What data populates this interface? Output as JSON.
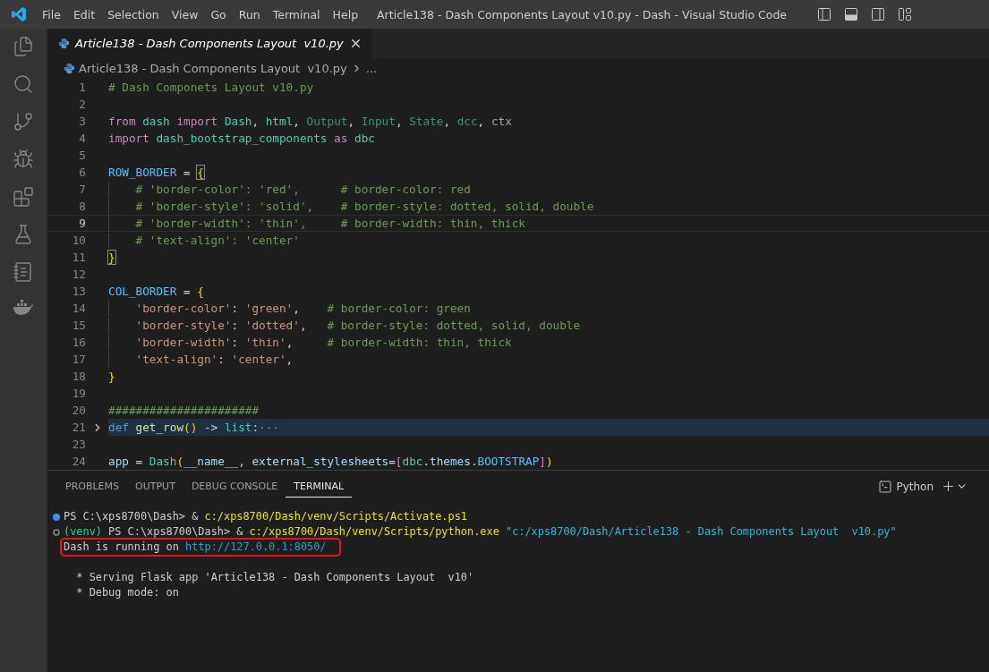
{
  "window": {
    "title": "Article138 - Dash Components Layout v10.py - Dash - Visual Studio Code",
    "menu": [
      "File",
      "Edit",
      "Selection",
      "View",
      "Go",
      "Run",
      "Terminal",
      "Help"
    ]
  },
  "tabs": [
    {
      "label": "Article138 - Dash Components Layout  v10.py",
      "selected": true,
      "italic": true
    }
  ],
  "breadcrumb": {
    "file": "Article138 - Dash Components Layout  v10.py",
    "more": "..."
  },
  "editor": {
    "lines": [
      {
        "number": "1",
        "current": false,
        "selected": false,
        "folded": false,
        "tokens": [
          {
            "kind": "comment",
            "text": "# Dash Componets Layout v10.py"
          }
        ]
      },
      {
        "number": "2",
        "current": false,
        "selected": false,
        "folded": false
      },
      {
        "number": "3",
        "current": false,
        "selected": false,
        "folded": false,
        "tokens": [
          {
            "kind": "control",
            "text": "from "
          },
          {
            "kind": "type",
            "text": "dash "
          },
          {
            "kind": "control",
            "text": "import "
          },
          {
            "kind": "type",
            "text": "Dash"
          },
          {
            "kind": "plain",
            "text": ", "
          },
          {
            "kind": "type",
            "text": "html"
          },
          {
            "kind": "plain",
            "text": ", "
          },
          {
            "kind": "faded",
            "text": "Output"
          },
          {
            "kind": "plain",
            "text": ", "
          },
          {
            "kind": "faded",
            "text": "Input"
          },
          {
            "kind": "plain",
            "text": ", "
          },
          {
            "kind": "faded",
            "text": "State"
          },
          {
            "kind": "plain",
            "text": ", "
          },
          {
            "kind": "faded",
            "text": "dcc"
          },
          {
            "kind": "plain",
            "text": ", "
          },
          {
            "kind": "dim",
            "text": "ctx"
          }
        ]
      },
      {
        "number": "4",
        "current": false,
        "selected": false,
        "folded": false,
        "tokens": [
          {
            "kind": "control",
            "text": "import "
          },
          {
            "kind": "type",
            "text": "dash_bootstrap_components "
          },
          {
            "kind": "control",
            "text": "as "
          },
          {
            "kind": "type",
            "text": "dbc"
          }
        ]
      },
      {
        "number": "5",
        "current": false,
        "selected": false,
        "folded": false
      },
      {
        "number": "6",
        "current": false,
        "selected": false,
        "folded": false,
        "tokens": [
          {
            "kind": "constant",
            "text": "ROW_BORDER"
          },
          {
            "kind": "plain",
            "text": " = "
          },
          {
            "kind": "bracket-match",
            "text": "{"
          }
        ]
      },
      {
        "number": "7",
        "current": false,
        "selected": false,
        "folded": false,
        "tokens": [
          {
            "kind": "comment",
            "text": "    # 'border-color': 'red',      # border-color: red"
          }
        ]
      },
      {
        "number": "8",
        "current": false,
        "selected": false,
        "folded": false,
        "tokens": [
          {
            "kind": "comment",
            "text": "    # 'border-style': 'solid',    # border-style: dotted, solid, double"
          }
        ]
      },
      {
        "number": "9",
        "current": true,
        "selected": false,
        "folded": false,
        "tokens": [
          {
            "kind": "comment",
            "text": "    # 'border-width': 'thin',     # border-width: thin, thick"
          }
        ]
      },
      {
        "number": "10",
        "current": false,
        "selected": false,
        "folded": false,
        "tokens": [
          {
            "kind": "comment",
            "text": "    # 'text-align': 'center'"
          }
        ]
      },
      {
        "number": "11",
        "current": false,
        "selected": false,
        "folded": false,
        "tokens": [
          {
            "kind": "bracket-match",
            "text": "}"
          }
        ]
      },
      {
        "number": "12",
        "current": false,
        "selected": false,
        "folded": false
      },
      {
        "number": "13",
        "current": false,
        "selected": false,
        "folded": false,
        "tokens": [
          {
            "kind": "constant",
            "text": "COL_BORDER"
          },
          {
            "kind": "plain",
            "text": " = "
          },
          {
            "kind": "bracket",
            "text": "{"
          }
        ]
      },
      {
        "number": "14",
        "current": false,
        "selected": false,
        "folded": false,
        "tokens": [
          {
            "kind": "string",
            "text": "    'border-color'"
          },
          {
            "kind": "plain",
            "text": ": "
          },
          {
            "kind": "string",
            "text": "'green'"
          },
          {
            "kind": "plain",
            "text": ",    "
          },
          {
            "kind": "comment",
            "text": "# border-color: green"
          }
        ]
      },
      {
        "number": "15",
        "current": false,
        "selected": false,
        "folded": false,
        "tokens": [
          {
            "kind": "string",
            "text": "    'border-style'"
          },
          {
            "kind": "plain",
            "text": ": "
          },
          {
            "kind": "string",
            "text": "'dotted'"
          },
          {
            "kind": "plain",
            "text": ",   "
          },
          {
            "kind": "comment",
            "text": "# border-style: dotted, solid, double"
          }
        ]
      },
      {
        "number": "16",
        "current": false,
        "selected": false,
        "folded": false,
        "tokens": [
          {
            "kind": "string",
            "text": "    'border-width'"
          },
          {
            "kind": "plain",
            "text": ": "
          },
          {
            "kind": "string",
            "text": "'thin'"
          },
          {
            "kind": "plain",
            "text": ",     "
          },
          {
            "kind": "comment",
            "text": "# border-width: thin, thick"
          }
        ]
      },
      {
        "number": "17",
        "current": false,
        "selected": false,
        "folded": false,
        "tokens": [
          {
            "kind": "string",
            "text": "    'text-align'"
          },
          {
            "kind": "plain",
            "text": ": "
          },
          {
            "kind": "string",
            "text": "'center'"
          },
          {
            "kind": "plain",
            "text": ","
          }
        ]
      },
      {
        "number": "18",
        "current": false,
        "selected": false,
        "folded": false,
        "tokens": [
          {
            "kind": "bracket",
            "text": "}"
          }
        ]
      },
      {
        "number": "19",
        "current": false,
        "selected": false,
        "folded": false
      },
      {
        "number": "20",
        "current": false,
        "selected": false,
        "folded": false,
        "tokens": [
          {
            "kind": "comment",
            "text": "######################"
          }
        ]
      },
      {
        "number": "21",
        "current": false,
        "selected": true,
        "folded": true,
        "tokens": [
          {
            "kind": "keyword",
            "text": "def "
          },
          {
            "kind": "func",
            "text": "get_row"
          },
          {
            "kind": "bracket",
            "text": "()"
          },
          {
            "kind": "plain",
            "text": " -> "
          },
          {
            "kind": "type",
            "text": "list"
          },
          {
            "kind": "plain",
            "text": ":"
          },
          {
            "kind": "ellipsis",
            "text": "···"
          }
        ]
      },
      {
        "number": "23",
        "current": false,
        "selected": false,
        "folded": false
      },
      {
        "number": "24",
        "current": false,
        "selected": false,
        "folded": false,
        "tokens": [
          {
            "kind": "var",
            "text": "app"
          },
          {
            "kind": "plain",
            "text": " = "
          },
          {
            "kind": "type",
            "text": "Dash"
          },
          {
            "kind": "bracket",
            "text": "("
          },
          {
            "kind": "var",
            "text": "__name__"
          },
          {
            "kind": "plain",
            "text": ", "
          },
          {
            "kind": "var",
            "text": "external_stylesheets"
          },
          {
            "kind": "plain",
            "text": "="
          },
          {
            "kind": "bracket2",
            "text": "["
          },
          {
            "kind": "type",
            "text": "dbc"
          },
          {
            "kind": "plain",
            "text": "."
          },
          {
            "kind": "var",
            "text": "themes"
          },
          {
            "kind": "plain",
            "text": "."
          },
          {
            "kind": "constant",
            "text": "BOOTSTRAP"
          },
          {
            "kind": "bracket2",
            "text": "]"
          },
          {
            "kind": "bracket",
            "text": ")"
          }
        ]
      }
    ]
  },
  "panel": {
    "tabs": [
      {
        "label": "PROBLEMS",
        "selected": false
      },
      {
        "label": "OUTPUT",
        "selected": false
      },
      {
        "label": "DEBUG CONSOLE",
        "selected": false
      },
      {
        "label": "TERMINAL",
        "selected": true
      }
    ],
    "shell": "Python",
    "lines": [
      {
        "kind": "success",
        "segments": [
          {
            "kind": "text",
            "text": "PS C:\\xps8700\\Dash> & "
          },
          {
            "kind": "path",
            "text": "c:/xps8700/Dash/venv/Scripts/Activate.ps1"
          }
        ]
      },
      {
        "kind": "pending",
        "segments": [
          {
            "kind": "venv",
            "text": "(venv)"
          },
          {
            "kind": "text",
            "text": " PS C:\\xps8700\\Dash> & "
          },
          {
            "kind": "path",
            "text": "c:/xps8700/Dash/venv/Scripts/python.exe"
          },
          {
            "kind": "string",
            "text": " \"c:/xps8700/Dash/Article138 - Dash Components Layout  v10.py\""
          }
        ]
      },
      {
        "kind": "boxed",
        "segments": [
          {
            "kind": "text",
            "text": "Dash is running on "
          },
          {
            "kind": "link",
            "text": "http://127.0.0.1:8050/"
          }
        ]
      },
      {
        "kind": "output"
      },
      {
        "kind": "output",
        "segments": [
          {
            "kind": "text",
            "text": "  * Serving Flask app 'Article138 - Dash Components Layout  v10'"
          }
        ]
      },
      {
        "kind": "output",
        "segments": [
          {
            "kind": "text",
            "text": "  * Debug mode: on"
          }
        ]
      }
    ]
  }
}
